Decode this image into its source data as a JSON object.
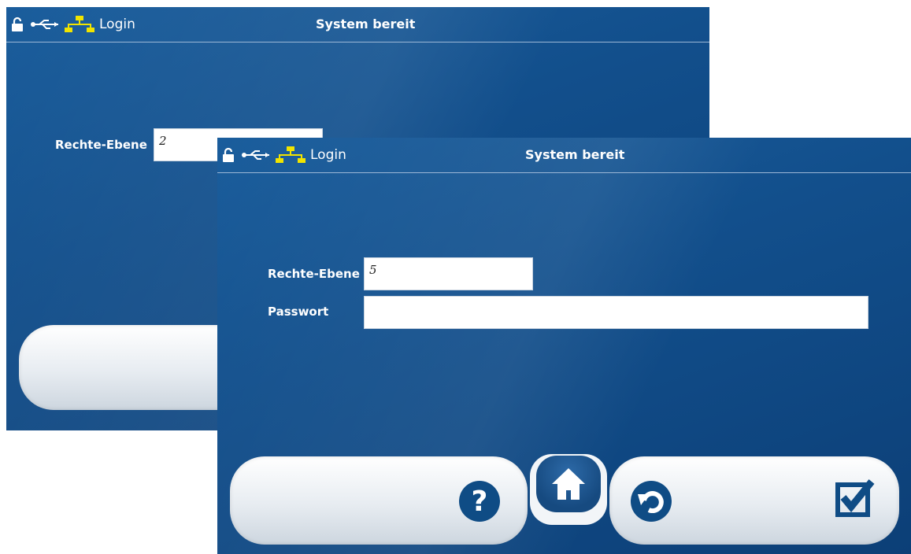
{
  "back_screen": {
    "status": {
      "login_label": "Login",
      "system_status": "System bereit"
    },
    "form": {
      "rights_level_label": "Rechte-Ebene",
      "rights_level_value": "2"
    }
  },
  "front_screen": {
    "status": {
      "login_label": "Login",
      "system_status": "System bereit"
    },
    "form": {
      "rights_level_label": "Rechte-Ebene",
      "rights_level_value": "5",
      "password_label": "Passwort",
      "password_value": ""
    },
    "bottom_buttons": [
      "help-icon",
      "home-icon",
      "back-icon",
      "confirm-checkbox-icon"
    ]
  },
  "colors": {
    "screen_blue": "#124f8c",
    "icon_yellow": "#f1e400",
    "button_blue": "#0f4c85"
  }
}
